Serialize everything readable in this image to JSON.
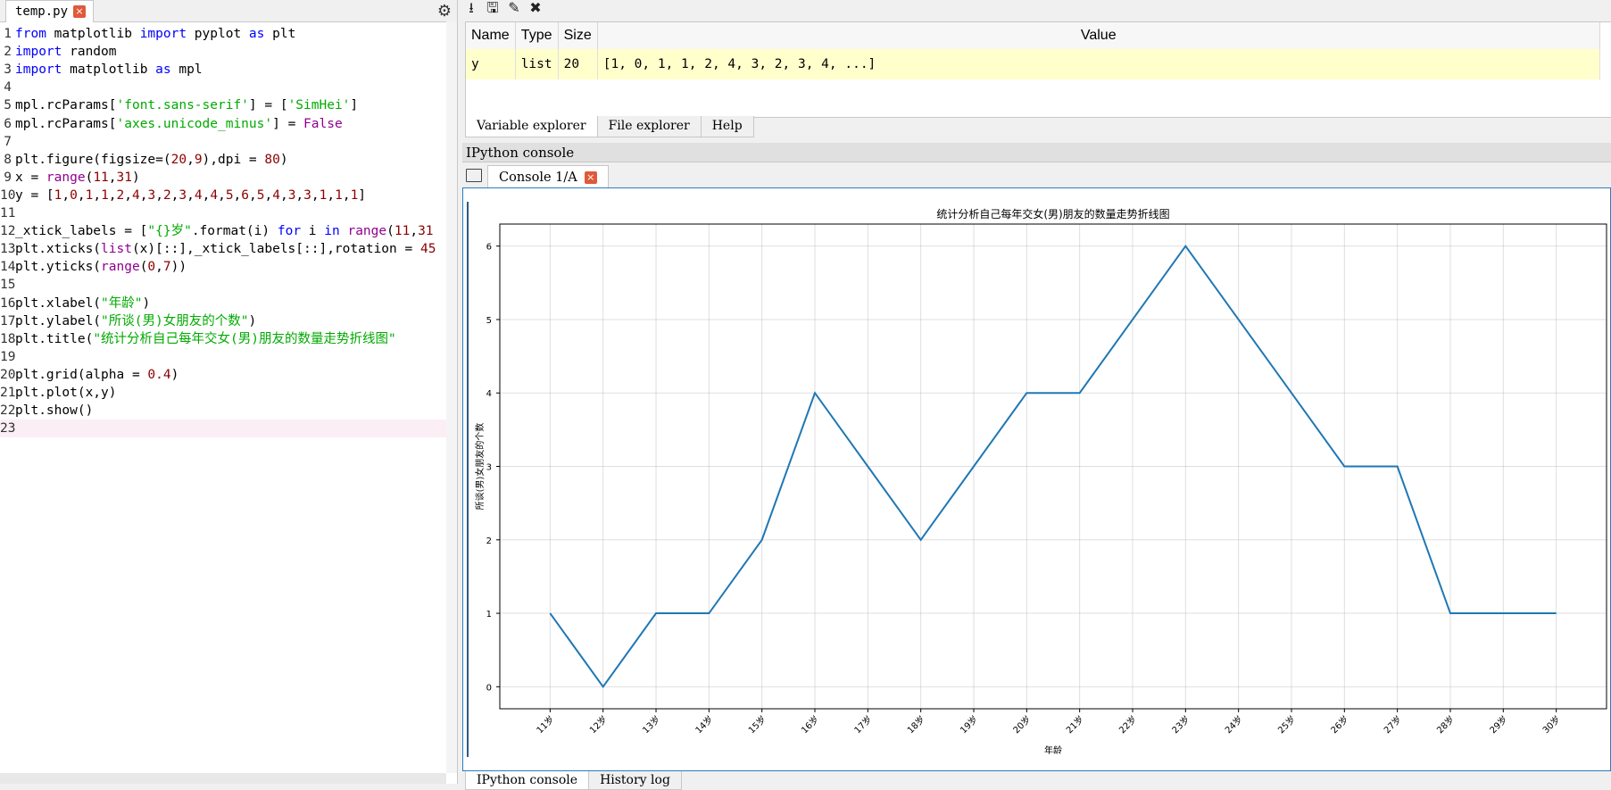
{
  "editor": {
    "tab_label": "temp.py",
    "close_label": "×",
    "lines": [
      {
        "n": "1",
        "html": "<span class=\"kw\">from</span> matplotlib <span class=\"kw\">import</span> pyplot <span class=\"kw\">as</span> plt"
      },
      {
        "n": "2",
        "html": "<span class=\"kw\">import</span> random"
      },
      {
        "n": "3",
        "html": "<span class=\"kw\">import</span> matplotlib <span class=\"kw\">as</span> mpl"
      },
      {
        "n": "4",
        "html": ""
      },
      {
        "n": "5",
        "html": "mpl.rcParams[<span class=\"str\">'font.sans-serif'</span>] = [<span class=\"str\">'SimHei'</span>]"
      },
      {
        "n": "6",
        "html": "mpl.rcParams[<span class=\"str\">'axes.unicode_minus'</span>] = <span class=\"bi\">False</span>"
      },
      {
        "n": "7",
        "html": ""
      },
      {
        "n": "8",
        "html": "plt.figure(figsize=(<span class=\"num\">20</span>,<span class=\"num\">9</span>),dpi = <span class=\"num\">80</span>)"
      },
      {
        "n": "9",
        "html": "x = <span class=\"bi\">range</span>(<span class=\"num\">11</span>,<span class=\"num\">31</span>)"
      },
      {
        "n": "10",
        "html": "y = [<span class=\"num\">1</span>,<span class=\"num\">0</span>,<span class=\"num\">1</span>,<span class=\"num\">1</span>,<span class=\"num\">2</span>,<span class=\"num\">4</span>,<span class=\"num\">3</span>,<span class=\"num\">2</span>,<span class=\"num\">3</span>,<span class=\"num\">4</span>,<span class=\"num\">4</span>,<span class=\"num\">5</span>,<span class=\"num\">6</span>,<span class=\"num\">5</span>,<span class=\"num\">4</span>,<span class=\"num\">3</span>,<span class=\"num\">3</span>,<span class=\"num\">1</span>,<span class=\"num\">1</span>,<span class=\"num\">1</span>]"
      },
      {
        "n": "11",
        "html": ""
      },
      {
        "n": "12",
        "html": "_xtick_labels = [<span class=\"str\">\"{}岁\"</span>.format(i) <span class=\"kw\">for</span> i <span class=\"kw\">in</span> <span class=\"bi\">range</span>(<span class=\"num\">11</span>,<span class=\"num\">31</span>"
      },
      {
        "n": "13",
        "html": "plt.xticks(<span class=\"bi\">list</span>(x)[::],_xtick_labels[::],rotation = <span class=\"num\">45</span>"
      },
      {
        "n": "14",
        "html": "plt.yticks(<span class=\"bi\">range</span>(<span class=\"num\">0</span>,<span class=\"num\">7</span>))"
      },
      {
        "n": "15",
        "html": ""
      },
      {
        "n": "16",
        "html": "plt.xlabel(<span class=\"str\">\"年龄\"</span>)"
      },
      {
        "n": "17",
        "html": "plt.ylabel(<span class=\"str\">\"所谈(男)女朋友的个数\"</span>)"
      },
      {
        "n": "18",
        "html": "plt.title(<span class=\"str\">\"统计分析自己每年交女(男)朋友的数量走势折线图\"</span>"
      },
      {
        "n": "19",
        "html": ""
      },
      {
        "n": "20",
        "html": "plt.grid(alpha = <span class=\"num\">0.4</span>)"
      },
      {
        "n": "21",
        "html": "plt.plot(x,y)"
      },
      {
        "n": "22",
        "html": "plt.show()"
      },
      {
        "n": "23",
        "html": ""
      }
    ]
  },
  "var_explorer": {
    "headers": {
      "name": "Name",
      "type": "Type",
      "size": "Size",
      "value": "Value"
    },
    "row": {
      "name": "y",
      "type": "list",
      "size": "20",
      "value": "[1, 0, 1, 1, 2, 4, 3, 2, 3, 4, ...]"
    }
  },
  "pane_tabs": [
    "Variable explorer",
    "File explorer",
    "Help"
  ],
  "ipython_header": "IPython console",
  "console_tab_label": "Console 1/A",
  "bottom_tabs": [
    "IPython console",
    "History log"
  ],
  "colors": {
    "line": "#1f77b4",
    "accent": "#2b7dbd",
    "close": "#e05a3a"
  },
  "chart_data": {
    "type": "line",
    "title": "统计分析自己每年交女(男)朋友的数量走势折线图",
    "xlabel": "年龄",
    "ylabel": "所谈(男)女朋友的个数",
    "x": [
      11,
      12,
      13,
      14,
      15,
      16,
      17,
      18,
      19,
      20,
      21,
      22,
      23,
      24,
      25,
      26,
      27,
      28,
      29,
      30
    ],
    "xtick_labels": [
      "11岁",
      "12岁",
      "13岁",
      "14岁",
      "15岁",
      "16岁",
      "17岁",
      "18岁",
      "19岁",
      "20岁",
      "21岁",
      "22岁",
      "23岁",
      "24岁",
      "25岁",
      "26岁",
      "27岁",
      "28岁",
      "29岁",
      "30岁"
    ],
    "values": [
      1,
      0,
      1,
      1,
      2,
      4,
      3,
      2,
      3,
      4,
      4,
      5,
      6,
      5,
      4,
      3,
      3,
      1,
      1,
      1
    ],
    "yticks": [
      0,
      1,
      2,
      3,
      4,
      5,
      6
    ],
    "ylim": [
      -0.3,
      6.3
    ],
    "xlim": [
      10.05,
      30.95
    ],
    "grid": true
  }
}
